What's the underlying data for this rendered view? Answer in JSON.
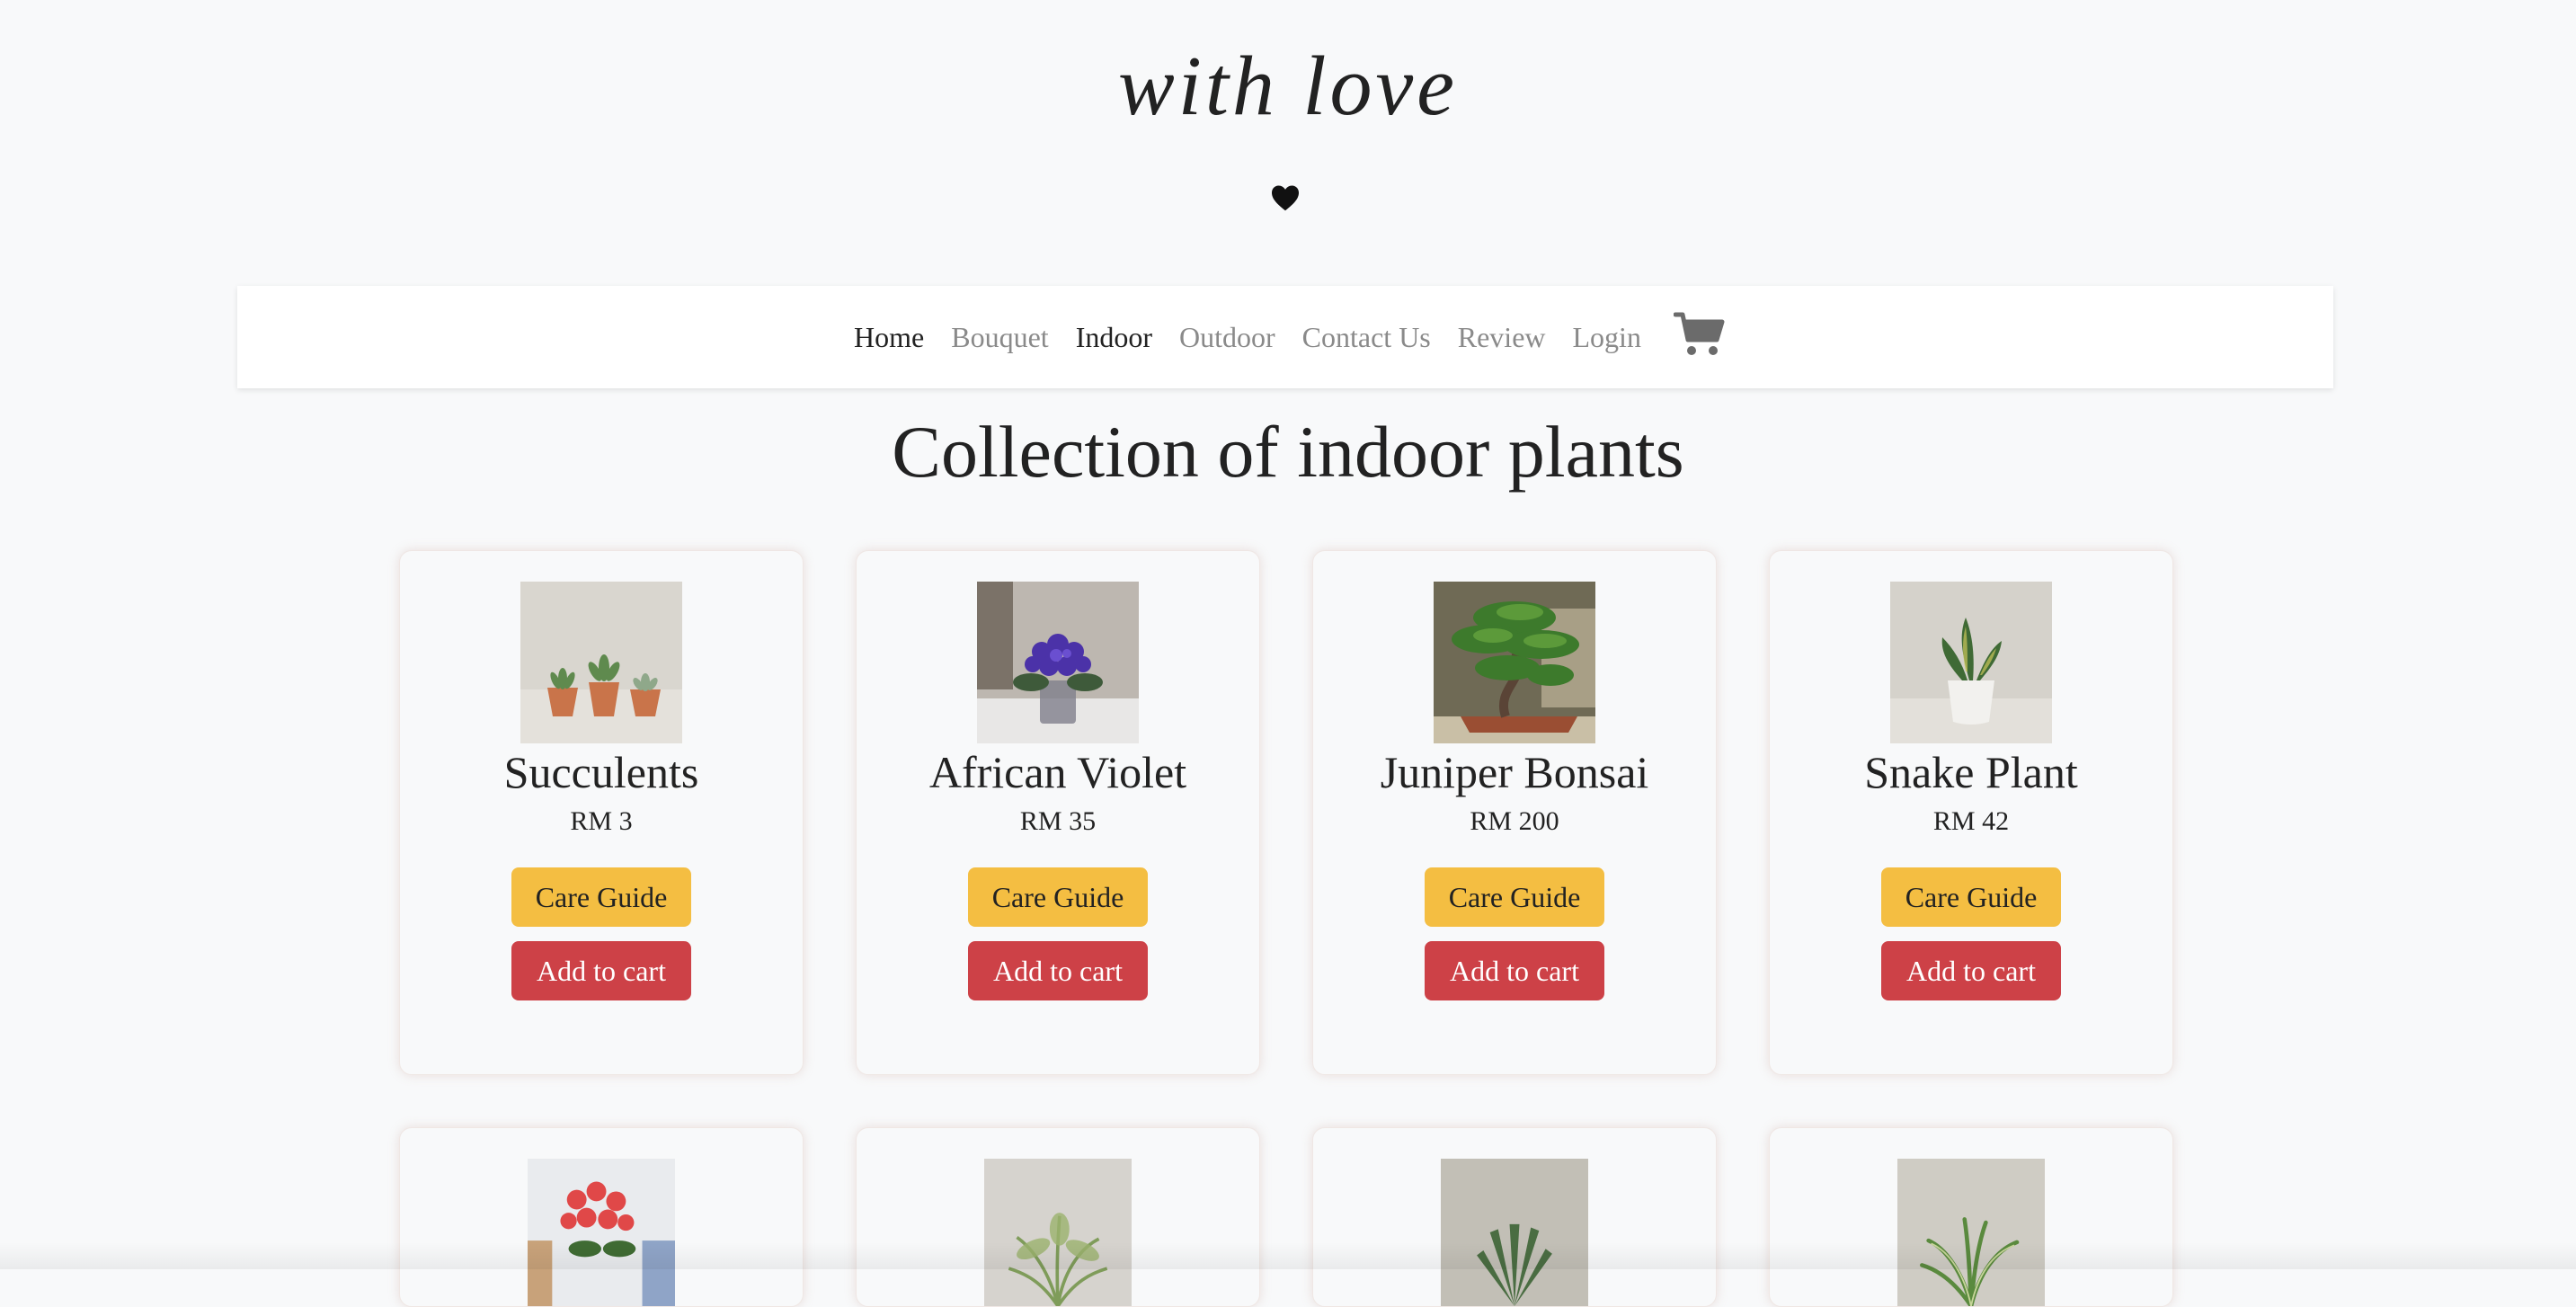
{
  "brand": {
    "title": "with love",
    "heart_icon": "heart-icon"
  },
  "nav": {
    "items": [
      {
        "label": "Home",
        "active": true
      },
      {
        "label": "Bouquet",
        "active": false
      },
      {
        "label": "Indoor",
        "active": true
      },
      {
        "label": "Outdoor",
        "active": false
      },
      {
        "label": "Contact Us",
        "active": false
      },
      {
        "label": "Review",
        "active": false
      },
      {
        "label": "Login",
        "active": false
      }
    ],
    "cart_icon": "cart-icon"
  },
  "page": {
    "title": "Collection of indoor plants"
  },
  "products": [
    {
      "name": "Succulents",
      "price": "RM 3",
      "care_label": "Care Guide",
      "cart_label": "Add to cart"
    },
    {
      "name": "African Violet",
      "price": "RM 35",
      "care_label": "Care Guide",
      "cart_label": "Add to cart"
    },
    {
      "name": "Juniper Bonsai",
      "price": "RM 200",
      "care_label": "Care Guide",
      "cart_label": "Add to cart"
    },
    {
      "name": "Snake Plant",
      "price": "RM 42",
      "care_label": "Care Guide",
      "cart_label": "Add to cart"
    }
  ],
  "colors": {
    "background": "#f8f9fa",
    "care_button": "#f4be42",
    "cart_button": "#cd4147",
    "nav_active": "#222222",
    "nav_inactive": "#8a8a8a"
  }
}
